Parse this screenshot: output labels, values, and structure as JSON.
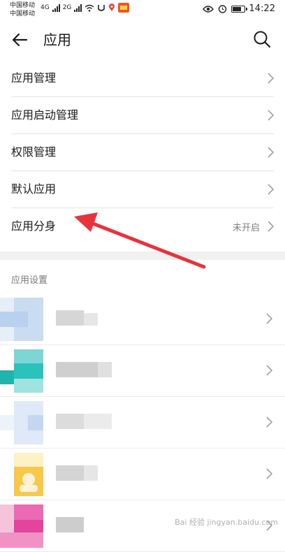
{
  "status": {
    "carrier1": "中国移动",
    "carrier2": "中国移动",
    "net1": "4G",
    "net2": "2G",
    "time": "14:22",
    "battery_level": 0.8
  },
  "header": {
    "title": "应用"
  },
  "menu": [
    {
      "label": "应用管理",
      "value": ""
    },
    {
      "label": "应用启动管理",
      "value": ""
    },
    {
      "label": "权限管理",
      "value": ""
    },
    {
      "label": "默认应用",
      "value": ""
    },
    {
      "label": "应用分身",
      "value": "未开启"
    }
  ],
  "section_title": "应用设置",
  "colors": {
    "accent_arrow": "#e8333c",
    "divider": "#e4e4e4",
    "section_bg": "#f1f1f1"
  },
  "watermark": "Bai 经验 jingyan.baidu.com"
}
